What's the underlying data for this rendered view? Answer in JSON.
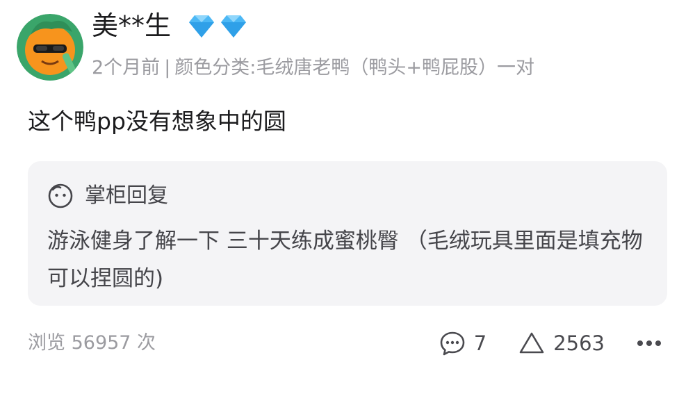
{
  "review": {
    "username": "美**生",
    "badge_icon": "diamond-icon",
    "badge_color": "#4cb8f5",
    "meta": {
      "time": "2个月前",
      "separator": "|",
      "variant": "颜色分类:毛绒唐老鸭（鸭头+鸭屁股）一对"
    },
    "text": "这个鸭pp没有想象中的圆"
  },
  "reply": {
    "icon": "shopkeeper-face-icon",
    "label": "掌柜回复",
    "text": "游泳健身了解一下  三十天练成蜜桃臀 （毛绒玩具里面是填充物 可以捏圆的)"
  },
  "footer": {
    "views": "浏览 56957 次",
    "comment_icon": "comment-icon",
    "comment_count": "7",
    "like_icon": "like-triangle-icon",
    "like_count": "2563",
    "more_icon": "more-dots-icon"
  },
  "colors": {
    "text_primary": "#1c1c1e",
    "text_secondary": "#9b9ba0",
    "reply_bg": "#f4f4f6",
    "avatar_bg": "#f7941d"
  }
}
